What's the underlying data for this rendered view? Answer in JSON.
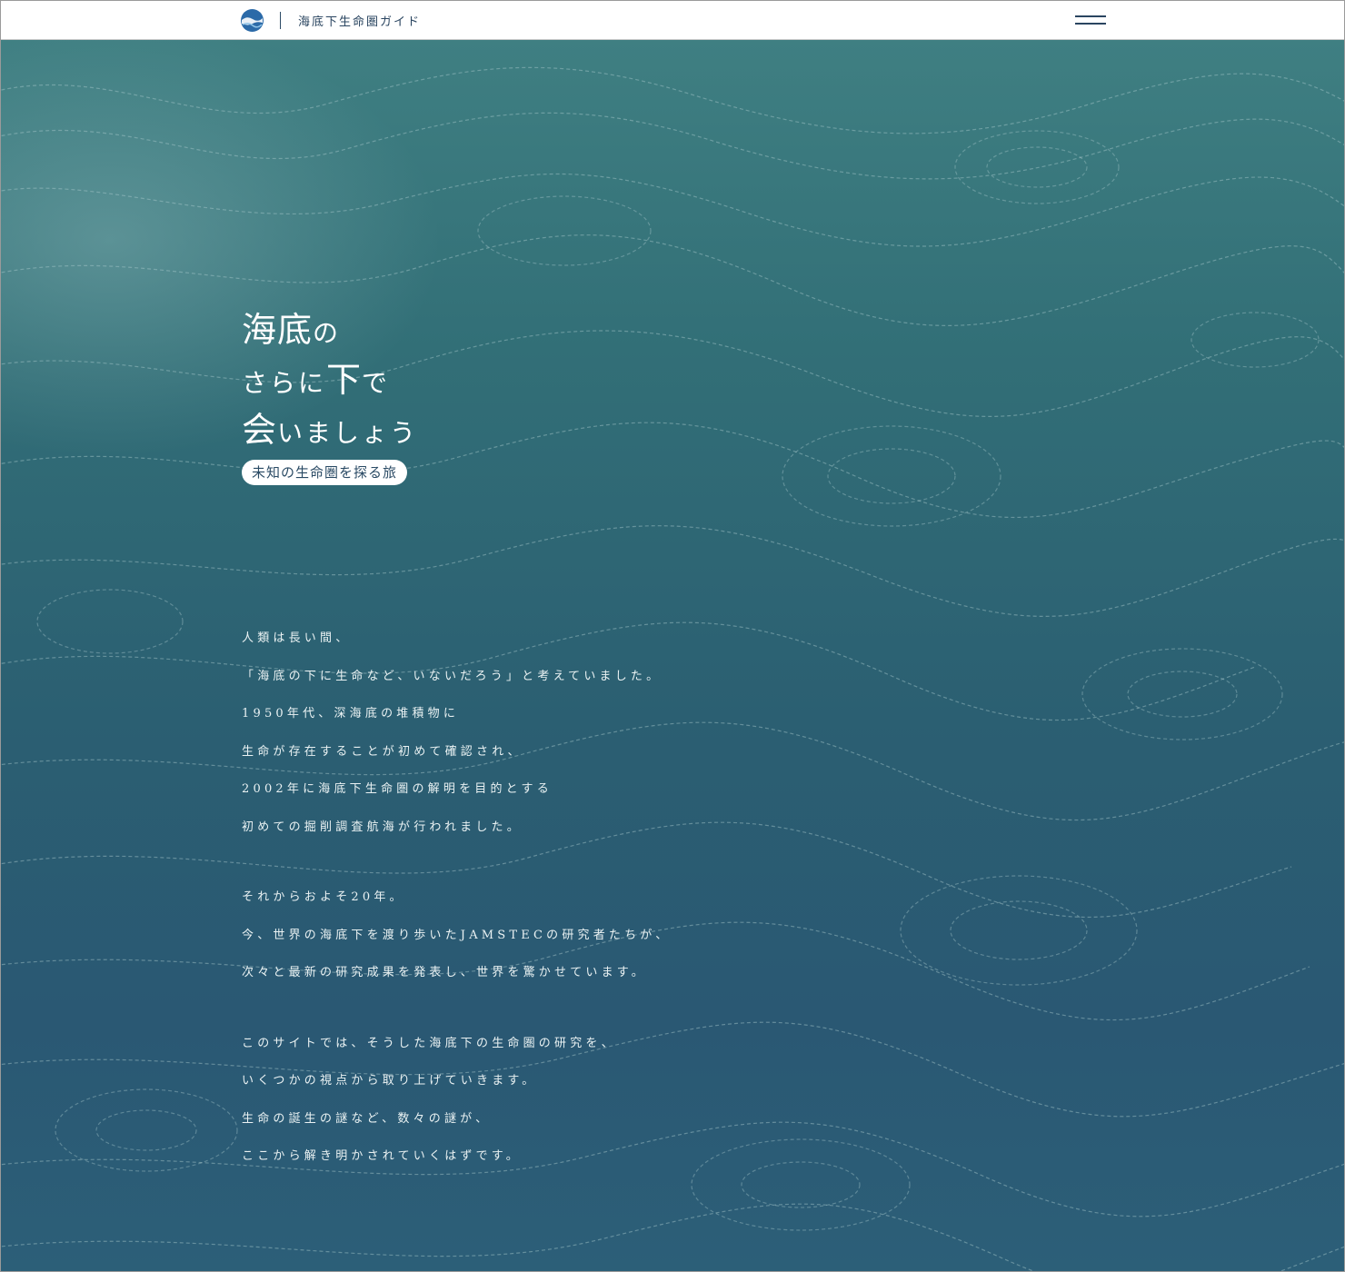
{
  "header": {
    "site_title": "海底下生命圏ガイド",
    "logo_icon": "jamstec-logo-icon",
    "menu_icon": "hamburger-menu-icon"
  },
  "hero": {
    "headline": {
      "line1_big": "海底",
      "line1_small": "の",
      "line2_small_a": "さらに",
      "line2_big": "下",
      "line2_small_b": "で",
      "line3_big": "会",
      "line3_small": "いましょう"
    },
    "badge": "未知の生命圏を探る旅",
    "paragraph1": [
      "人類は長い間、",
      "「海底の下に生命など、いないだろう」と考えていました。",
      "1950年代、深海底の堆積物に",
      "生命が存在することが初めて確認され、",
      "2002年に海底下生命圏の解明を目的とする",
      "初めての掘削調査航海が行われました。"
    ],
    "paragraph2": [
      "それからおよそ20年。",
      "今、世界の海底下を渡り歩いたJAMSTECの研究者たちが、",
      "次々と最新の研究成果を発表し、世界を驚かせています。"
    ],
    "paragraph3": [
      "このサイトでは、そうした海底下の生命圏の研究を、",
      "いくつかの視点から取り上げていきます。",
      "生命の誕生の謎など、数々の謎が、",
      "ここから解き明かされていくはずです。"
    ]
  },
  "colors": {
    "header_bg": "#ffffff",
    "header_text": "#2a4560",
    "hero_top": "#3f7f82",
    "hero_bottom": "#2a5873",
    "contour_lines": "#a9c9cc"
  }
}
